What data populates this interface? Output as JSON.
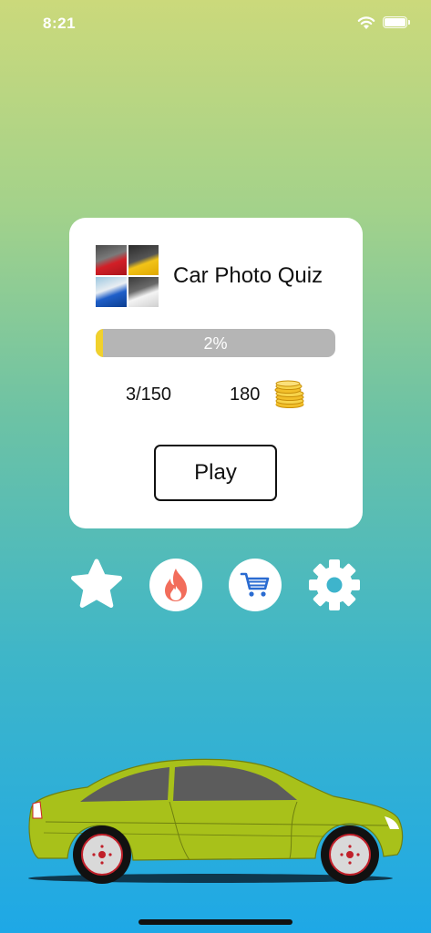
{
  "status_bar": {
    "time": "8:21"
  },
  "quiz_card": {
    "title": "Car Photo Quiz",
    "progress_percent": 2,
    "progress_label": "2%",
    "questions_answered": "3/150",
    "coins": "180"
  },
  "play_button": {
    "label": "Play"
  },
  "icons": [
    "star-icon",
    "fire-icon",
    "cart-icon",
    "gear-icon",
    "coins-icon",
    "wifi-icon",
    "battery-icon"
  ],
  "colors": {
    "gradient_top": "#cbd97b",
    "gradient_bottom": "#1ea8e6",
    "progress_fill": "#f1d12c",
    "progress_track": "#b5b5b5",
    "fire": "#f26d5b",
    "cart": "#2a6bd1",
    "car_body": "#a8c11a"
  }
}
